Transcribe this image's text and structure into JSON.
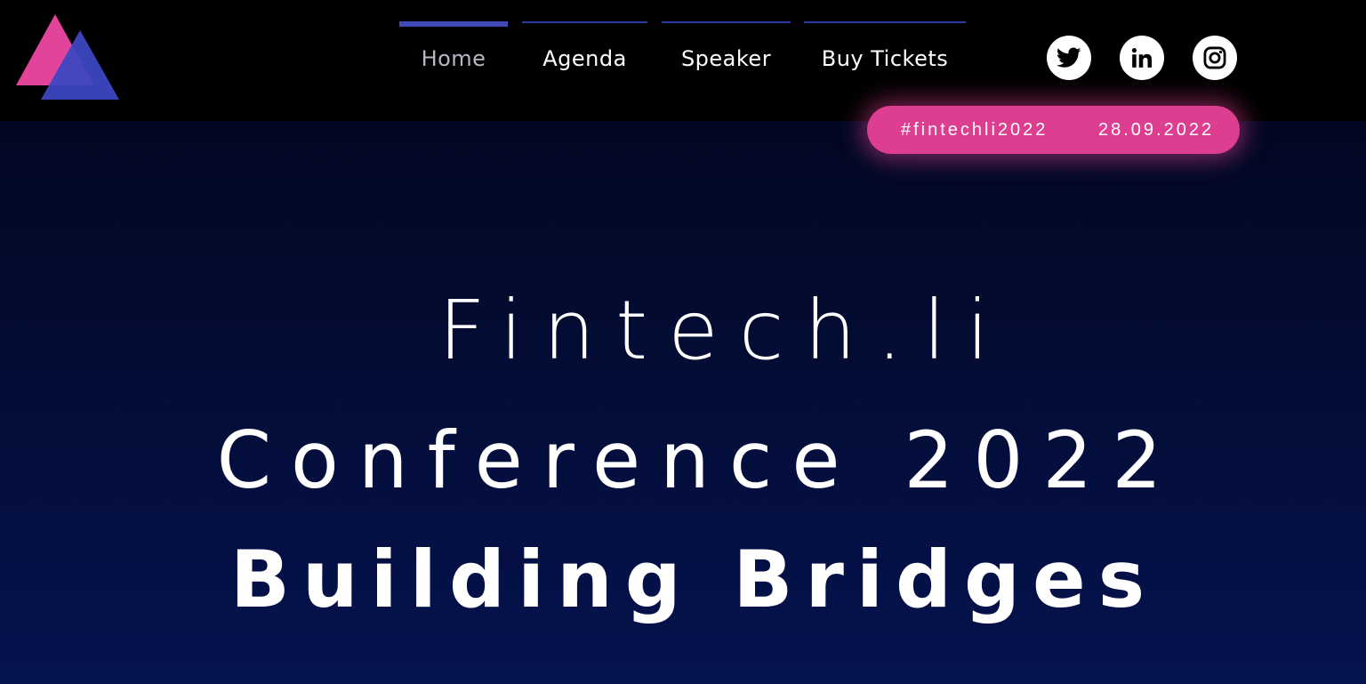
{
  "brand": {
    "logo_icon": "triangles-logo-icon",
    "colors": {
      "pink": "#e2449a",
      "blue": "#3d47c0",
      "accent": "#dd3e8f"
    }
  },
  "nav": {
    "items": [
      {
        "label": "Home",
        "active": true
      },
      {
        "label": "Agenda",
        "active": false
      },
      {
        "label": "Speaker",
        "active": false
      },
      {
        "label": "Buy Tickets",
        "active": false
      }
    ]
  },
  "social": [
    {
      "icon": "twitter-icon"
    },
    {
      "icon": "linkedin-icon"
    },
    {
      "icon": "instagram-icon"
    }
  ],
  "event_pill": {
    "hashtag": "#fintechli2022",
    "date": "28.09.2022"
  },
  "hero": {
    "line1": "Fintech.li",
    "line2": "Conference 2022",
    "line3": "Building Bridges"
  }
}
